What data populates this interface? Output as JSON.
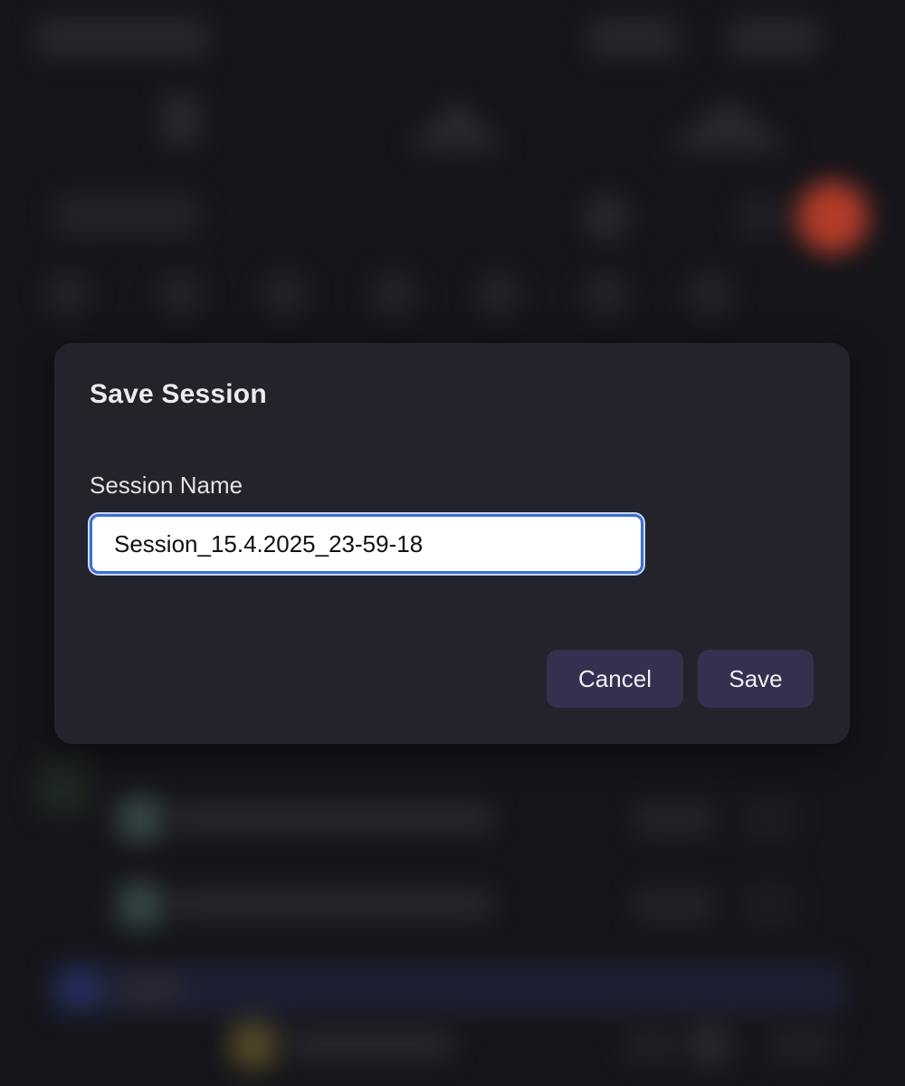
{
  "dialog": {
    "title": "Save Session",
    "field_label": "Session Name",
    "session_name_value": "Session_15.4.2025_23-59-18",
    "cancel_label": "Cancel",
    "save_label": "Save"
  },
  "colors": {
    "backdrop": "#15151a",
    "dialog_bg": "#23232b",
    "button_bg": "#35304f",
    "input_focus_border": "#3a6fd6",
    "background_accent_red": "#c4402c"
  }
}
